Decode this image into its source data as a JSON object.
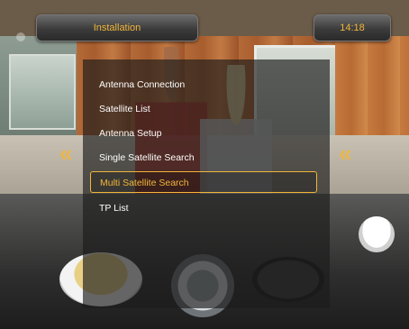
{
  "header": {
    "title": "Installation",
    "time": "14:18"
  },
  "menu": {
    "items": [
      {
        "label": "Antenna Connection",
        "selected": false
      },
      {
        "label": "Satellite List",
        "selected": false
      },
      {
        "label": "Antenna Setup",
        "selected": false
      },
      {
        "label": "Single Satellite Search",
        "selected": false
      },
      {
        "label": "Multi Satellite Search",
        "selected": true
      },
      {
        "label": "TP List",
        "selected": false
      }
    ]
  },
  "colors": {
    "accent": "#f2b63a",
    "menu_text": "#ffffff",
    "panel_bg": "rgba(28,28,28,0.66)"
  },
  "icons": {
    "left_arrow": "double-chevron-left-icon",
    "right_arrow": "double-chevron-right-icon"
  }
}
